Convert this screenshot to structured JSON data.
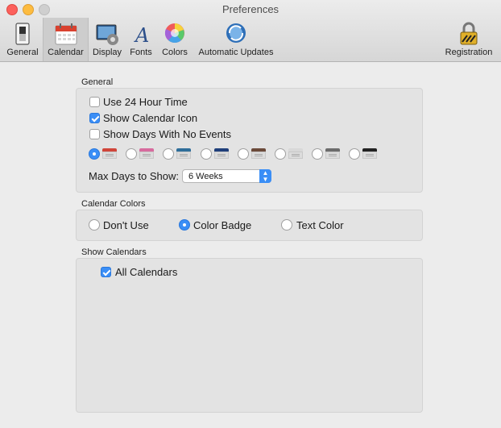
{
  "window": {
    "title": "Preferences"
  },
  "toolbar": {
    "items": [
      {
        "label": "General",
        "icon": "general-switch-icon"
      },
      {
        "label": "Calendar",
        "icon": "calendar-icon",
        "active": true
      },
      {
        "label": "Display",
        "icon": "display-gear-icon"
      },
      {
        "label": "Fonts",
        "icon": "fonts-icon"
      },
      {
        "label": "Colors",
        "icon": "color-wheel-icon"
      },
      {
        "label": "Automatic Updates",
        "icon": "sync-globe-icon"
      },
      {
        "label": "Registration",
        "icon": "padlock-icon"
      }
    ]
  },
  "general": {
    "title": "General",
    "use24": {
      "label": "Use 24 Hour Time",
      "checked": false
    },
    "showIcon": {
      "label": "Show Calendar Icon",
      "checked": true
    },
    "showDays": {
      "label": "Show Days With No Events",
      "checked": false
    },
    "icon_styles": [
      {
        "color": "#d0453a",
        "selected": true
      },
      {
        "color": "#d76b9e",
        "selected": false
      },
      {
        "color": "#2f6e9a",
        "selected": false
      },
      {
        "color": "#1f3f7a",
        "selected": false
      },
      {
        "color": "#6b4a3a",
        "selected": false
      },
      {
        "color": "#d8d8d8",
        "selected": false
      },
      {
        "color": "#6c6c6c",
        "selected": false
      },
      {
        "color": "#222222",
        "selected": false
      }
    ],
    "maxDays": {
      "label": "Max Days to Show:",
      "value": "6 Weeks"
    }
  },
  "calendarColors": {
    "title": "Calendar Colors",
    "options": [
      {
        "label": "Don't Use",
        "selected": false
      },
      {
        "label": "Color Badge",
        "selected": true
      },
      {
        "label": "Text Color",
        "selected": false
      }
    ]
  },
  "showCalendars": {
    "title": "Show Calendars",
    "all": {
      "label": "All Calendars",
      "checked": true
    }
  }
}
